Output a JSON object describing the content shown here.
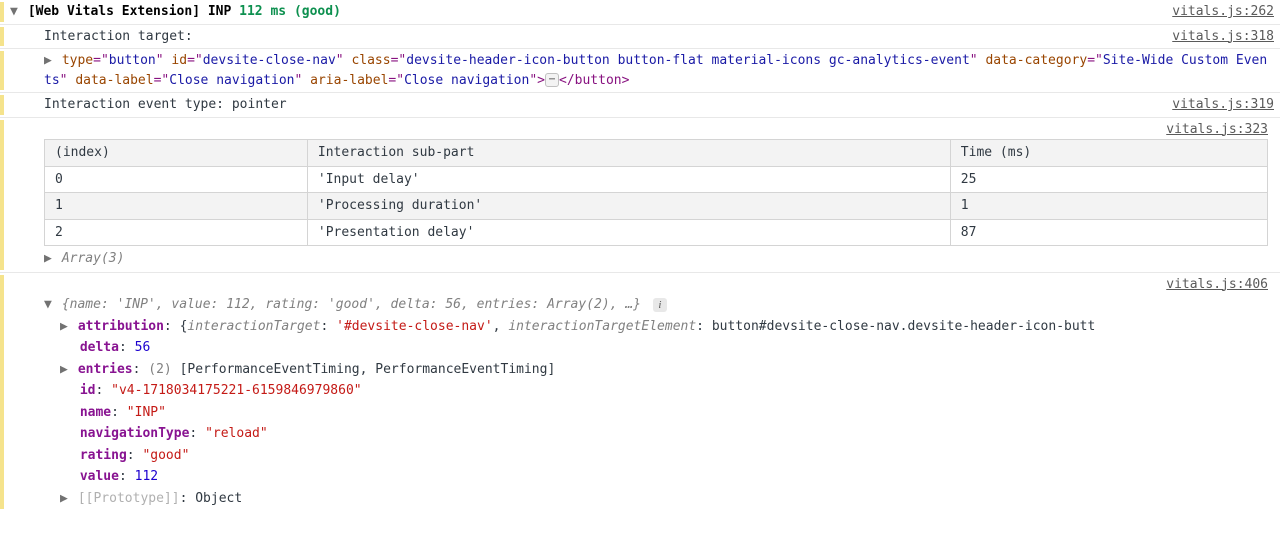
{
  "header": {
    "prefix": "[Web Vitals Extension] INP",
    "value": "112 ms (good)",
    "source": "vitals.js:262"
  },
  "interaction_target": {
    "label": "Interaction target:",
    "source": "vitals.js:318"
  },
  "button_html": {
    "tag_open": "<button",
    "attrs": [
      {
        "n": "type",
        "v": "button"
      },
      {
        "n": "id",
        "v": "devsite-close-nav"
      },
      {
        "n": "class",
        "v": "devsite-header-icon-button button-flat material-icons gc-analytics-event"
      },
      {
        "n": "data-category",
        "v": "Site-Wide Custom Events"
      },
      {
        "n": "data-label",
        "v": "Close navigation"
      },
      {
        "n": "aria-label",
        "v": "Close navigation"
      }
    ],
    "close": "</button>"
  },
  "event_type": {
    "text": "Interaction event type: pointer",
    "source": "vitals.js:319"
  },
  "table_block": {
    "source": "vitals.js:323",
    "headers": [
      "(index)",
      "Interaction sub-part",
      "Time (ms)"
    ],
    "rows": [
      {
        "i": "0",
        "part": "'Input delay'",
        "t": "25"
      },
      {
        "i": "1",
        "part": "'Processing duration'",
        "t": "1"
      },
      {
        "i": "2",
        "part": "'Presentation delay'",
        "t": "87"
      }
    ],
    "array_label": "Array(3)"
  },
  "obj": {
    "source": "vitals.js:406",
    "summary_prefix": "{",
    "summary_pairs": [
      {
        "k": "name",
        "v": "'INP'"
      },
      {
        "k": "value",
        "v": "112"
      },
      {
        "k": "rating",
        "v": "'good'"
      },
      {
        "k": "delta",
        "v": "56"
      },
      {
        "k": "entries",
        "v": "Array(2)"
      }
    ],
    "summary_suffix": ", …}",
    "attribution": {
      "key": "attribution",
      "open": "{",
      "pairs": [
        {
          "k": "interactionTarget",
          "v": "'#devsite-close-nav'",
          "vstyle": "str"
        },
        {
          "k": "interactionTargetElement",
          "v": "button#devsite-close-nav.devsite-header-icon-butt",
          "vstyle": "plain"
        }
      ]
    },
    "props": [
      {
        "k": "delta",
        "v": "56",
        "type": "num"
      },
      {
        "k": "entries",
        "count": "(2)",
        "v": "[PerformanceEventTiming, PerformanceEventTiming]",
        "type": "arr",
        "d": true
      },
      {
        "k": "id",
        "v": "\"v4-1718034175221-6159846979860\"",
        "type": "str"
      },
      {
        "k": "name",
        "v": "\"INP\"",
        "type": "str"
      },
      {
        "k": "navigationType",
        "v": "\"reload\"",
        "type": "str"
      },
      {
        "k": "rating",
        "v": "\"good\"",
        "type": "str"
      },
      {
        "k": "value",
        "v": "112",
        "type": "num"
      },
      {
        "k": "[[Prototype]]",
        "v": "Object",
        "type": "plain",
        "d": true,
        "dim": true
      }
    ]
  },
  "chart_data": {
    "type": "table",
    "title": "INP breakdown",
    "categories": [
      "Input delay",
      "Processing duration",
      "Presentation delay"
    ],
    "values": [
      25,
      1,
      87
    ],
    "xlabel": "Interaction sub-part",
    "ylabel": "Time (ms)"
  }
}
